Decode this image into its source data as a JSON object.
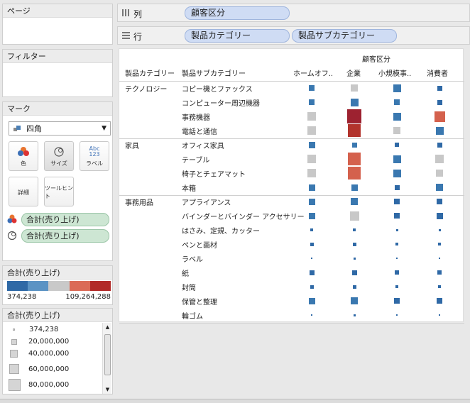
{
  "panels": {
    "pages": "ページ",
    "filters": "フィルター",
    "marks": "マーク",
    "mark_type": "四角",
    "buttons": {
      "color": "色",
      "size": "サイズ",
      "label": "ラベル",
      "label_icon": "Abc\n123",
      "detail": "詳細",
      "tooltip": "ツールヒント"
    },
    "pills": [
      "合計(売り上げ)",
      "合計(売り上げ)"
    ]
  },
  "legend_color": {
    "title": "合計(売り上げ)",
    "min": "374,238",
    "max": "109,264,288",
    "colors": [
      "#2f69a6",
      "#5b93c4",
      "#c9c9c9",
      "#db6b57",
      "#b22a28"
    ]
  },
  "legend_size": {
    "title": "合計(売り上げ)",
    "items": [
      "374,238",
      "20,000,000",
      "40,000,000",
      "60,000,000",
      "80,000,000"
    ]
  },
  "shelves": {
    "cols_label": "列",
    "rows_label": "行",
    "cols_pills": [
      "顧客区分"
    ],
    "rows_pills": [
      "製品カテゴリー",
      "製品サブカテゴリー"
    ]
  },
  "view": {
    "top_header": "顧客区分",
    "row_header_1": "製品カテゴリー",
    "row_header_2": "製品サブカテゴリー",
    "columns": [
      "ホームオフ..",
      "企業",
      "小規模事..",
      "消費者"
    ],
    "categories": [
      {
        "name": "テクノロジー",
        "subs": [
          "コピー機とファックス",
          "コンピューター周辺機器",
          "事務機器",
          "電話と通信"
        ]
      },
      {
        "name": "家具",
        "subs": [
          "オフィス家具",
          "テーブル",
          "椅子とチェアマット",
          "本箱"
        ]
      },
      {
        "name": "事務用品",
        "subs": [
          "アプライアンス",
          "バインダーとバインダー アクセサリー",
          "はさみ、定規、カッター",
          "ペンと画材",
          "ラベル",
          "紙",
          "封筒",
          "保管と整理",
          "輪ゴム"
        ]
      }
    ],
    "marks": [
      [
        {
          "s": 8,
          "c": "#3a78b0"
        },
        {
          "s": 10,
          "c": "#c8c8c8"
        },
        {
          "s": 11,
          "c": "#3a78b0"
        },
        {
          "s": 7,
          "c": "#2f69a6"
        }
      ],
      [
        {
          "s": 8,
          "c": "#3a78b0"
        },
        {
          "s": 11,
          "c": "#3a78b0"
        },
        {
          "s": 8,
          "c": "#3a78b0"
        },
        {
          "s": 7,
          "c": "#2f69a6"
        }
      ],
      [
        {
          "s": 12,
          "c": "#c8c8c8"
        },
        {
          "s": 20,
          "c": "#9d2230"
        },
        {
          "s": 11,
          "c": "#3a78b0"
        },
        {
          "s": 15,
          "c": "#d4614d"
        }
      ],
      [
        {
          "s": 12,
          "c": "#c8c8c8"
        },
        {
          "s": 18,
          "c": "#b2332c"
        },
        {
          "s": 10,
          "c": "#c8c8c8"
        },
        {
          "s": 11,
          "c": "#3a78b0"
        }
      ],
      [
        {
          "s": 9,
          "c": "#3a78b0"
        },
        {
          "s": 7,
          "c": "#3a78b0"
        },
        {
          "s": 6,
          "c": "#2f69a6"
        },
        {
          "s": 7,
          "c": "#2f69a6"
        }
      ],
      [
        {
          "s": 12,
          "c": "#c8c8c8"
        },
        {
          "s": 18,
          "c": "#d4614d"
        },
        {
          "s": 11,
          "c": "#3a78b0"
        },
        {
          "s": 12,
          "c": "#c8c8c8"
        }
      ],
      [
        {
          "s": 12,
          "c": "#c8c8c8"
        },
        {
          "s": 18,
          "c": "#d4614d"
        },
        {
          "s": 11,
          "c": "#3a78b0"
        },
        {
          "s": 10,
          "c": "#c8c8c8"
        }
      ],
      [
        {
          "s": 9,
          "c": "#3a78b0"
        },
        {
          "s": 9,
          "c": "#3a78b0"
        },
        {
          "s": 7,
          "c": "#2f69a6"
        },
        {
          "s": 10,
          "c": "#3a78b0"
        }
      ],
      [
        {
          "s": 9,
          "c": "#3a78b0"
        },
        {
          "s": 10,
          "c": "#3a78b0"
        },
        {
          "s": 8,
          "c": "#2f69a6"
        },
        {
          "s": 8,
          "c": "#2f69a6"
        }
      ],
      [
        {
          "s": 9,
          "c": "#3a78b0"
        },
        {
          "s": 13,
          "c": "#c8c8c8"
        },
        {
          "s": 8,
          "c": "#2f69a6"
        },
        {
          "s": 9,
          "c": "#2f69a6"
        }
      ],
      [
        {
          "s": 4,
          "c": "#2f69a6"
        },
        {
          "s": 4,
          "c": "#2f69a6"
        },
        {
          "s": 3,
          "c": "#2f69a6"
        },
        {
          "s": 3,
          "c": "#2f69a6"
        }
      ],
      [
        {
          "s": 5,
          "c": "#2f69a6"
        },
        {
          "s": 5,
          "c": "#2f69a6"
        },
        {
          "s": 4,
          "c": "#2f69a6"
        },
        {
          "s": 4,
          "c": "#2f69a6"
        }
      ],
      [
        {
          "s": 2,
          "c": "#2f69a6"
        },
        {
          "s": 3,
          "c": "#2f69a6"
        },
        {
          "s": 2,
          "c": "#2f69a6"
        },
        {
          "s": 2,
          "c": "#2f69a6"
        }
      ],
      [
        {
          "s": 7,
          "c": "#2f69a6"
        },
        {
          "s": 7,
          "c": "#2f69a6"
        },
        {
          "s": 6,
          "c": "#2f69a6"
        },
        {
          "s": 6,
          "c": "#2f69a6"
        }
      ],
      [
        {
          "s": 5,
          "c": "#2f69a6"
        },
        {
          "s": 5,
          "c": "#2f69a6"
        },
        {
          "s": 4,
          "c": "#2f69a6"
        },
        {
          "s": 4,
          "c": "#2f69a6"
        }
      ],
      [
        {
          "s": 9,
          "c": "#3a78b0"
        },
        {
          "s": 10,
          "c": "#3a78b0"
        },
        {
          "s": 8,
          "c": "#2f69a6"
        },
        {
          "s": 8,
          "c": "#2f69a6"
        }
      ],
      [
        {
          "s": 2,
          "c": "#2f69a6"
        },
        {
          "s": 3,
          "c": "#2f69a6"
        },
        {
          "s": 2,
          "c": "#2f69a6"
        },
        {
          "s": 2,
          "c": "#2f69a6"
        }
      ]
    ]
  }
}
